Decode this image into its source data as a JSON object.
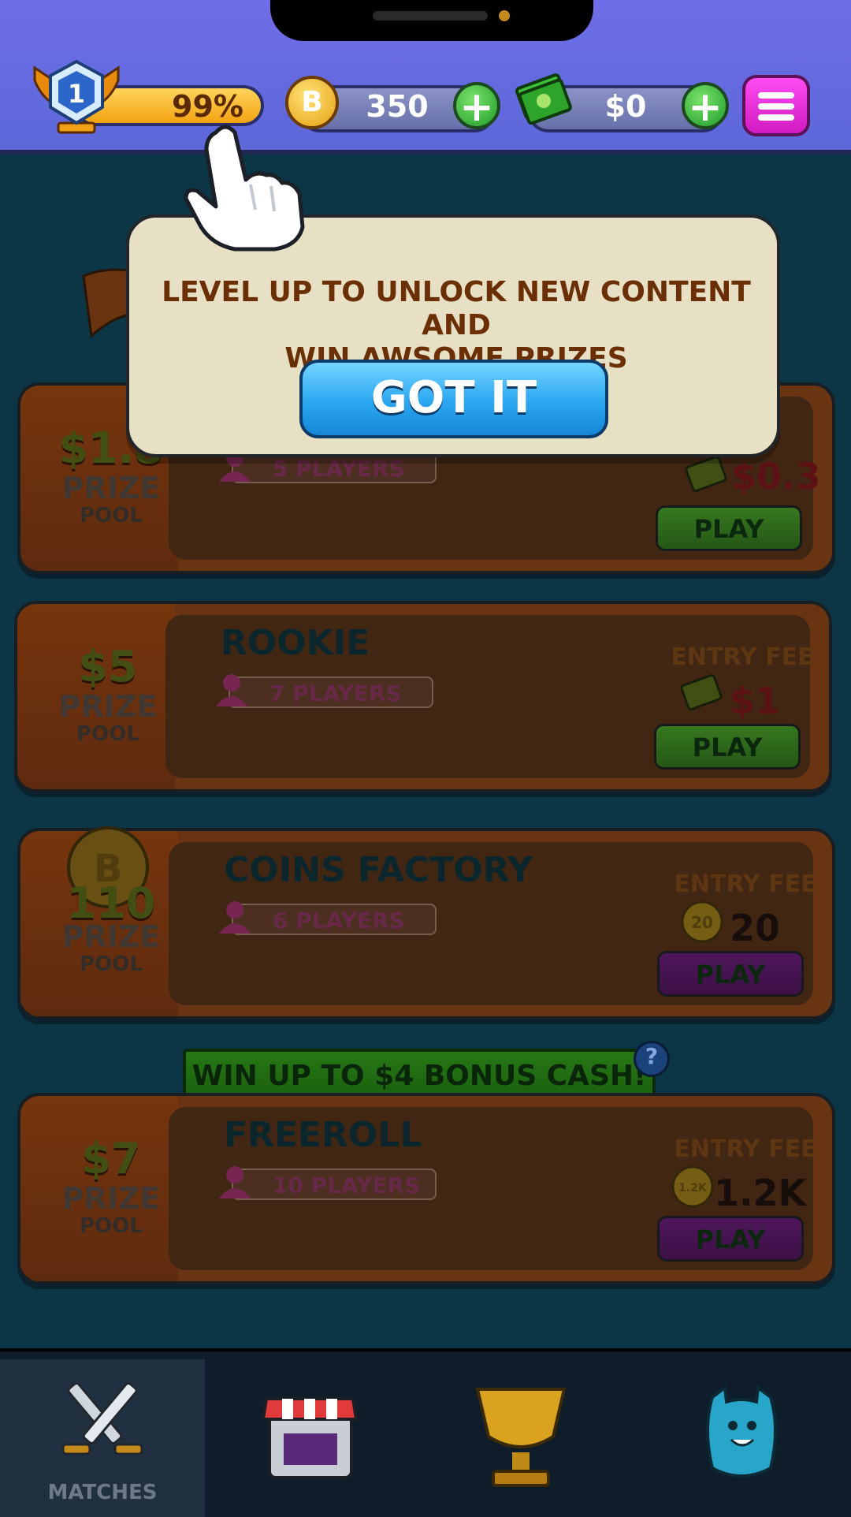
{
  "topbar": {
    "level": "1",
    "xp_percent_text": "99%",
    "coins": "350",
    "cash": "$0",
    "plus": "+"
  },
  "tooltip": {
    "message_line1": "LEVEL UP TO UNLOCK NEW CONTENT AND",
    "message_line2": "WIN AWSOME PRIZES",
    "button_label": "GOT IT"
  },
  "matches": [
    {
      "prize_amount": "$1.8",
      "prize_label": "PRIZE",
      "pool_label": "POOL",
      "title": "",
      "players": "5 PLAYERS",
      "entry_fee_label": "E",
      "entry_fee_value": "$0.3",
      "play_label": "PLAY"
    },
    {
      "prize_amount": "$5",
      "prize_label": "PRIZE",
      "pool_label": "POOL",
      "title": "ROOKIE",
      "players": "7 PLAYERS",
      "entry_fee_label": "ENTRY FEE",
      "entry_fee_value": "$1",
      "play_label": "PLAY"
    },
    {
      "prize_amount": "110",
      "prize_label": "PRIZE",
      "pool_label": "POOL",
      "title": "COINS FACTORY",
      "players": "6 PLAYERS",
      "entry_fee_label": "ENTRY FEE",
      "entry_fee_value": "20",
      "coin_icon_text": "20",
      "play_label": "PLAY"
    },
    {
      "prize_amount": "$7",
      "prize_label": "PRIZE",
      "pool_label": "POOL",
      "title": "FREEROLL",
      "players": "10 PLAYERS",
      "entry_fee_label": "ENTRY FEE",
      "entry_fee_value": "1.2K",
      "coin_icon_text": "1.2K",
      "play_label": "PLAY"
    }
  ],
  "bonus_banner": {
    "text": "WIN UP TO $4 BONUS CASH!",
    "help": "?"
  },
  "bottom_nav": {
    "matches_label": "MATCHES"
  },
  "colors": {
    "topbar": "#6f6ee8",
    "tooltip_bg": "#e7e0c4",
    "tooltip_text": "#6b2f06",
    "got_it": "#2aa6f0",
    "play_green": "#3f8a1f",
    "play_purple": "#5b1765"
  }
}
